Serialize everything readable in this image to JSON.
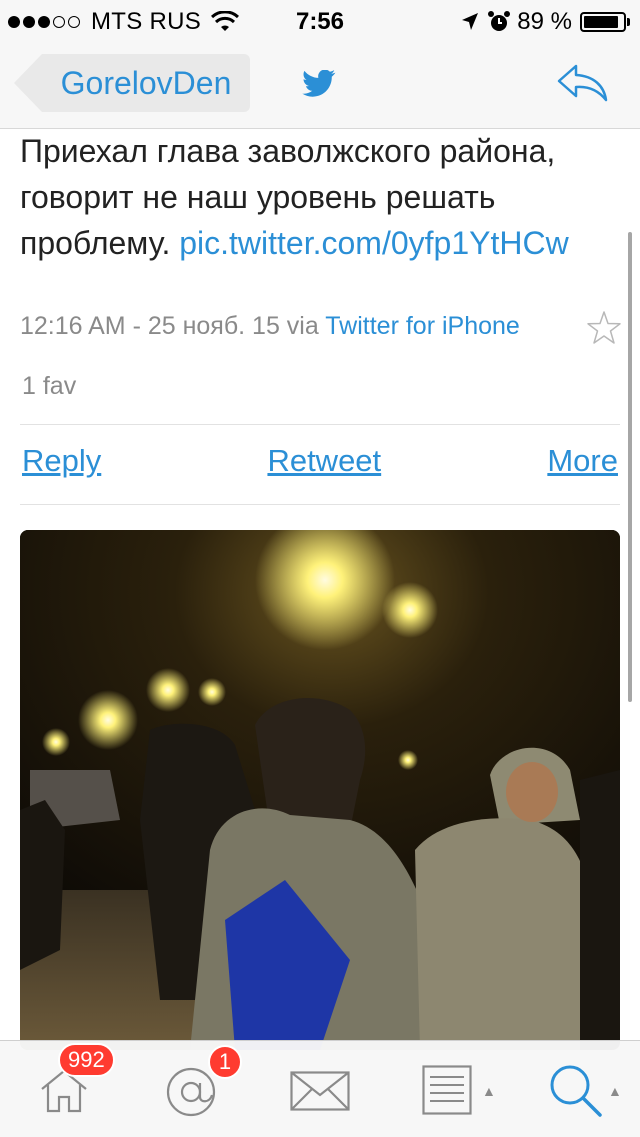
{
  "status_bar": {
    "carrier": "MTS RUS",
    "time": "7:56",
    "battery": "89 %",
    "battery_level": 0.89,
    "signal_bars_filled": 3,
    "signal_bars_total": 5
  },
  "nav": {
    "back_label": "GorelovDen",
    "center_icon": "twitter-bird-icon",
    "right_icon": "reply-arrow-icon"
  },
  "tweet": {
    "text": "Приехал глава заволжского района, говорит не наш уровень решать проблему.",
    "link": "pic.twitter.com/0yfp1YtHCw",
    "meta_time": "12:16 AM - 25 нояб. 15 via",
    "source": "Twitter for iPhone",
    "favs": "1 fav"
  },
  "actions": {
    "reply": "Reply",
    "retweet": "Retweet",
    "more": "More"
  },
  "tab_bar": {
    "home_badge": "992",
    "mentions_badge": "1",
    "icons": [
      "home-icon",
      "mentions-icon",
      "messages-icon",
      "lists-icon",
      "search-icon"
    ]
  },
  "colors": {
    "link": "#2b8fd6",
    "badge": "#ff3b30",
    "meta": "#8a8a8a"
  }
}
